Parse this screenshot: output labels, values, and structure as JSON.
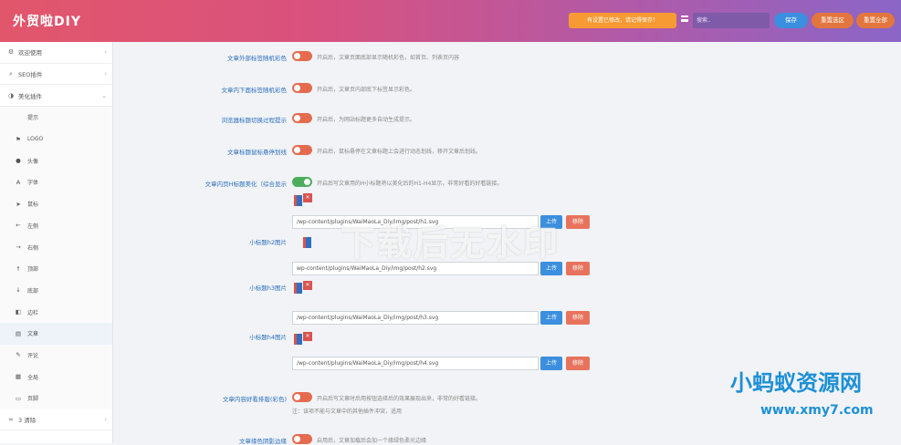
{
  "header": {
    "title": "外贸啦DIY",
    "warning_label": "有设置已修改，请记得保存！",
    "search_placeholder": "搜索..",
    "save_label": "保存",
    "reset_selected_label": "重置选区",
    "reset_all_label": "重置全部",
    "gradient_colors": [
      "#e2566b",
      "#8a66c7"
    ]
  },
  "sidebar": {
    "items": [
      {
        "label": "欢迎使用",
        "icon": "gear-icon"
      },
      {
        "label": "SEO插件",
        "icon": "search-icon"
      },
      {
        "label": "美化插件",
        "icon": "palette-icon"
      }
    ],
    "sub_items": [
      {
        "label": "提示",
        "icon": ""
      },
      {
        "label": "LOGO",
        "icon": "flag-icon"
      },
      {
        "label": "头像",
        "icon": "user-icon"
      },
      {
        "label": "字体",
        "icon": "font-icon"
      },
      {
        "label": "鼠标",
        "icon": "cursor-icon"
      },
      {
        "label": "左侧",
        "icon": "arrow-left-icon"
      },
      {
        "label": "右侧",
        "icon": "arrow-right-icon"
      },
      {
        "label": "顶部",
        "icon": "arrow-up-icon"
      },
      {
        "label": "底部",
        "icon": "arrow-down-icon"
      },
      {
        "label": "边栏",
        "icon": "sidebar-icon"
      },
      {
        "label": "文章",
        "icon": "article-icon"
      },
      {
        "label": "评论",
        "icon": "comment-icon"
      },
      {
        "label": "全局",
        "icon": "grid-icon"
      },
      {
        "label": "页脚",
        "icon": "footer-icon"
      }
    ],
    "last_item": {
      "label": "3 清除",
      "icon": "link-icon"
    }
  },
  "settings": {
    "rows": [
      {
        "label": "文章外部标签随机彩色",
        "desc": "开启后，文章页面底部显示随机彩色，如首页、列表页内容",
        "on": false
      },
      {
        "label": "文章内下面标签随机彩色",
        "desc": "开启后，文章页内部底下标签显示彩色。",
        "on": false
      },
      {
        "label": "浏览器标题切换过程提示",
        "desc": "开启后，为网站标题更多自动生成提示。",
        "on": false
      },
      {
        "label": "文章标题鼠标悬停划线",
        "desc": "开启后，鼠标悬停在文章标题上会进行动态划线，移开文章后划线。",
        "on": false
      },
      {
        "label": "文章内页H标题美化（综合显示",
        "desc": "开启后写文章用的H小标题将以美化后的H1-H4显示，非常好看的好看链接。",
        "on": true
      }
    ],
    "images": [
      {
        "label": "",
        "path": "/wp-content/plugins/WaiMaoLa_Diy/img/post/h1.svg",
        "upload": "上传",
        "remove": "移除"
      },
      {
        "label": "小标题h2图片",
        "path": "wp-content/plugins/WaiMaoLa_Diy/img/post/h2.svg",
        "upload": "上传",
        "remove": "移除"
      },
      {
        "label": "小标题h3图片",
        "path": "/wp-content/plugins/WaiMaoLa_Diy/img/post/h3.svg",
        "upload": "上传",
        "remove": "移除"
      },
      {
        "label": "小标题h4图片",
        "path": "/wp-content/plugins/WaiMaoLa_Diy/img/post/h4.svg",
        "upload": "上传",
        "remove": "移除"
      }
    ],
    "bottom_rows": [
      {
        "label": "文章内容好看排版(彩色)",
        "desc": "开启后写文章时后用按钮选择后的效果展现出来，非常的好看链接。",
        "on": false
      },
      {
        "label": "文章缘色阴影边缘",
        "desc": "启用后，文章加载后会加一个缘绿色柔光边缘",
        "on": false
      }
    ],
    "note": "注：该项不能与文章中的其他插件冲突，适用"
  },
  "watermarks": {
    "center": "下载后无水印",
    "brand": "小蚂蚁资源网",
    "url": "www.xmy7.com"
  }
}
